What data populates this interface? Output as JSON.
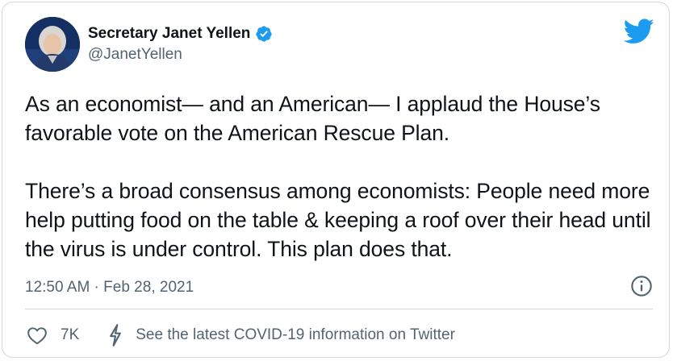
{
  "author": {
    "display_name": "Secretary Janet Yellen",
    "handle": "@JanetYellen",
    "verified": true,
    "avatar_icon": "avatar-portrait"
  },
  "tweet": {
    "text": "As an economist— and an American— I applaud the House’s favorable vote on the American Rescue Plan.\n\nThere’s a broad consensus among economists: People need more help putting food on the table & keeping a roof over their head until the virus is under control. This plan does that.",
    "timestamp": "12:50 AM · Feb 28, 2021"
  },
  "actions": {
    "like_count": "7K",
    "covid_link": "See the latest COVID-19 information on Twitter"
  },
  "icons": {
    "brand": "twitter-bird-icon",
    "info": "info-icon",
    "like": "heart-icon",
    "covid": "lightning-icon",
    "verified": "verified-badge-icon"
  },
  "colors": {
    "brand_blue": "#1d9bf0",
    "text_primary": "#0f1419",
    "text_secondary": "#536471",
    "border": "#cfd9de"
  }
}
